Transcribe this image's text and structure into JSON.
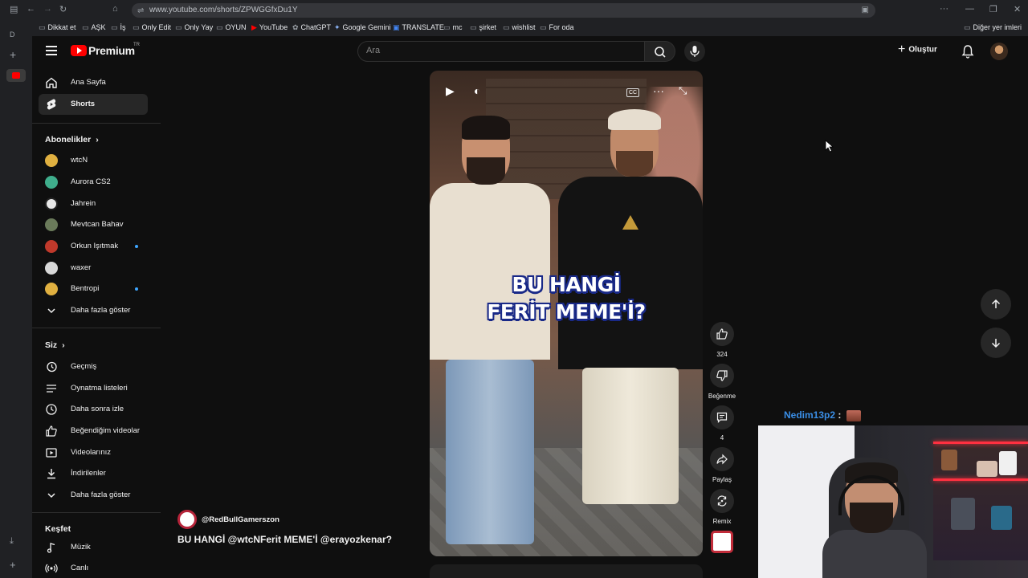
{
  "browser": {
    "url": "www.youtube.com/shorts/ZPWGGfxDu1Y",
    "bookmarks": [
      "Dikkat et",
      "AŞK",
      "İş",
      "Only Edit",
      "Only Yay",
      "OYUN",
      "YouTube",
      "ChatGPT",
      "Google Gemini",
      "TRANSLATE",
      "mc",
      "şirket",
      "wishlist",
      "For oda"
    ],
    "bookmarks_other": "Diğer yer imleri"
  },
  "masthead": {
    "logo": "Premium",
    "logo_sup": "TR",
    "search_placeholder": "Ara",
    "create_label": "Oluştur"
  },
  "guide": {
    "main": [
      {
        "label": "Ana Sayfa",
        "icon": "home-icon"
      },
      {
        "label": "Shorts",
        "icon": "shorts-icon"
      }
    ],
    "subscriptions_title": "Abonelikler",
    "subscriptions": [
      {
        "label": "wtcN",
        "color": "#e0b040",
        "dot": false
      },
      {
        "label": "Aurora CS2",
        "color": "#3fae8c",
        "dot": false
      },
      {
        "label": "Jahrein",
        "color": "#e8e8e8",
        "dot": false
      },
      {
        "label": "Mevtcan Bahav",
        "color": "#6a7a5a",
        "dot": false
      },
      {
        "label": "Orkun Işıtmak",
        "color": "#c0392b",
        "dot": true
      },
      {
        "label": "waxer",
        "color": "#d8d8d8",
        "dot": false
      },
      {
        "label": "Bentropi",
        "color": "#e0b040",
        "dot": true
      }
    ],
    "subs_more": "Daha fazla göster",
    "you_title": "Siz",
    "you": [
      {
        "label": "Geçmiş",
        "icon": "history-icon"
      },
      {
        "label": "Oynatma listeleri",
        "icon": "playlist-icon"
      },
      {
        "label": "Daha sonra izle",
        "icon": "clock-icon"
      },
      {
        "label": "Beğendiğim videolar",
        "icon": "like-icon"
      },
      {
        "label": "Videolarınız",
        "icon": "your-videos-icon"
      },
      {
        "label": "İndirilenler",
        "icon": "download-icon"
      }
    ],
    "you_more": "Daha fazla göster",
    "explore_title": "Keşfet",
    "explore": [
      {
        "label": "Müzik",
        "icon": "music-icon"
      },
      {
        "label": "Canlı",
        "icon": "live-icon"
      }
    ]
  },
  "short": {
    "caption_line1": "BU HANGİ",
    "caption_line2": "FERİT MEME'İ?",
    "channel": "@RedBullGamerszon",
    "title": "BU HANGİ @wtcNFerit MEME'İ @erayozkenar?",
    "likes": "324",
    "dislike_label": "Beğenme",
    "comments": "4",
    "share_label": "Paylaş",
    "remix_label": "Remix"
  },
  "overlay": {
    "chat_user": "Nedim13p2",
    "chat_sep": ":"
  }
}
